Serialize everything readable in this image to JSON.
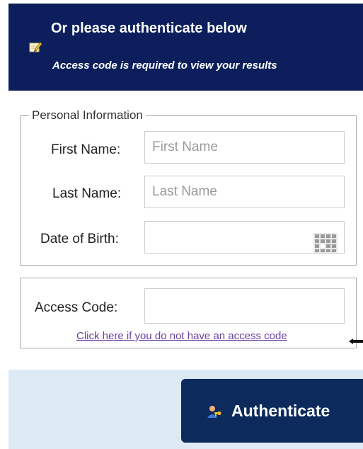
{
  "header": {
    "title": "Or please authenticate below",
    "subtitle": "Access code is required to view your results",
    "icon": "pencil-note-icon",
    "background_color": "#0c1f5c"
  },
  "personal_info": {
    "legend": "Personal Information",
    "first_name": {
      "label": "First Name:",
      "value": "",
      "placeholder": "First Name"
    },
    "last_name": {
      "label": "Last Name:",
      "value": "",
      "placeholder": "Last Name"
    },
    "dob": {
      "label": "Date of Birth:",
      "value": "",
      "icon": "calendar-icon"
    }
  },
  "access": {
    "label": "Access Code:",
    "value": "",
    "link_text": "Click here if you do not have an access code",
    "link_color": "#6b3fa0"
  },
  "footer": {
    "background_color": "#dde9f4",
    "authenticate_label": "Authenticate",
    "authenticate_icon": "user-key-icon",
    "button_color": "#0c2a5c"
  }
}
